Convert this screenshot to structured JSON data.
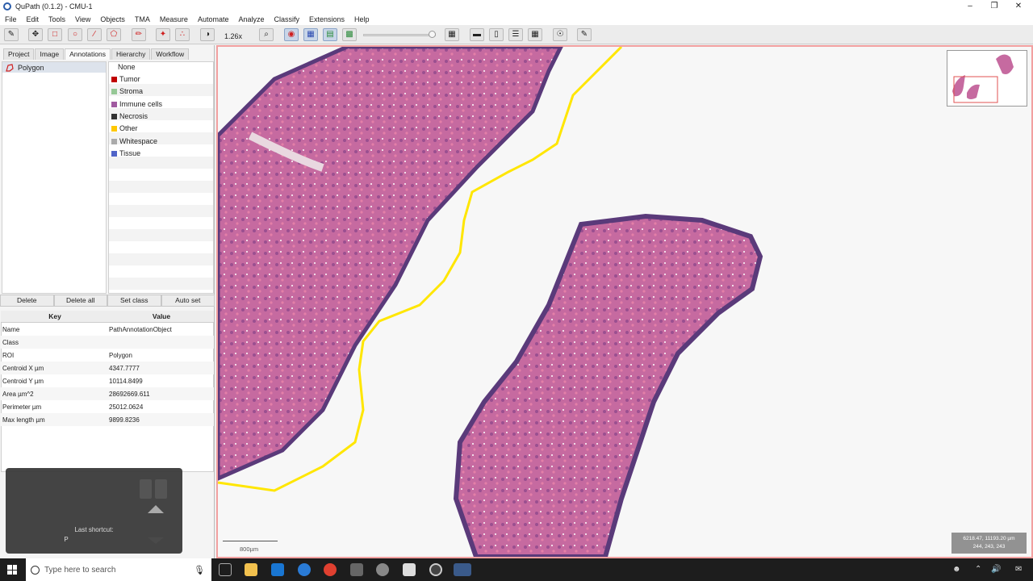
{
  "window": {
    "title": "QuPath (0.1.2) - CMU-1"
  },
  "menu": [
    "File",
    "Edit",
    "Tools",
    "View",
    "Objects",
    "TMA",
    "Measure",
    "Automate",
    "Analyze",
    "Classify",
    "Extensions",
    "Help"
  ],
  "toolbar": {
    "zoom": "1.26x"
  },
  "tabs": [
    "Project",
    "Image",
    "Annotations",
    "Hierarchy",
    "Workflow"
  ],
  "annotations": {
    "items": [
      "Polygon"
    ],
    "header_class": "None"
  },
  "classes": [
    {
      "name": "Tumor",
      "color": "#c00000"
    },
    {
      "name": "Stroma",
      "color": "#96c896"
    },
    {
      "name": "Immune cells",
      "color": "#a05aa0"
    },
    {
      "name": "Necrosis",
      "color": "#323232"
    },
    {
      "name": "Other",
      "color": "#ffc800"
    },
    {
      "name": "Whitespace",
      "color": "#aaaaaa"
    },
    {
      "name": "Tissue",
      "color": "#5064c8"
    }
  ],
  "actions": {
    "delete": "Delete",
    "delete_all": "Delete all",
    "set_class": "Set class",
    "auto_set": "Auto set"
  },
  "properties": {
    "key_header": "Key",
    "value_header": "Value",
    "rows": [
      {
        "k": "Name",
        "v": "PathAnnotationObject"
      },
      {
        "k": "Class",
        "v": ""
      },
      {
        "k": "ROI",
        "v": "Polygon"
      },
      {
        "k": "Centroid X µm",
        "v": "4347.7777"
      },
      {
        "k": "Centroid Y µm",
        "v": "10114.8499"
      },
      {
        "k": "Area µm^2",
        "v": "28692669.611"
      },
      {
        "k": "Perimeter µm",
        "v": "25012.0624"
      },
      {
        "k": "Max length µm",
        "v": "9899.8236"
      }
    ]
  },
  "shortcut": {
    "label": "Last shortcut:",
    "key": "P"
  },
  "viewer": {
    "scale_label": "800µm",
    "coords_line1": "6218.47, 11193.20 µm",
    "coords_line2": "244, 243, 243"
  },
  "taskbar": {
    "search_placeholder": "Type here to search"
  }
}
